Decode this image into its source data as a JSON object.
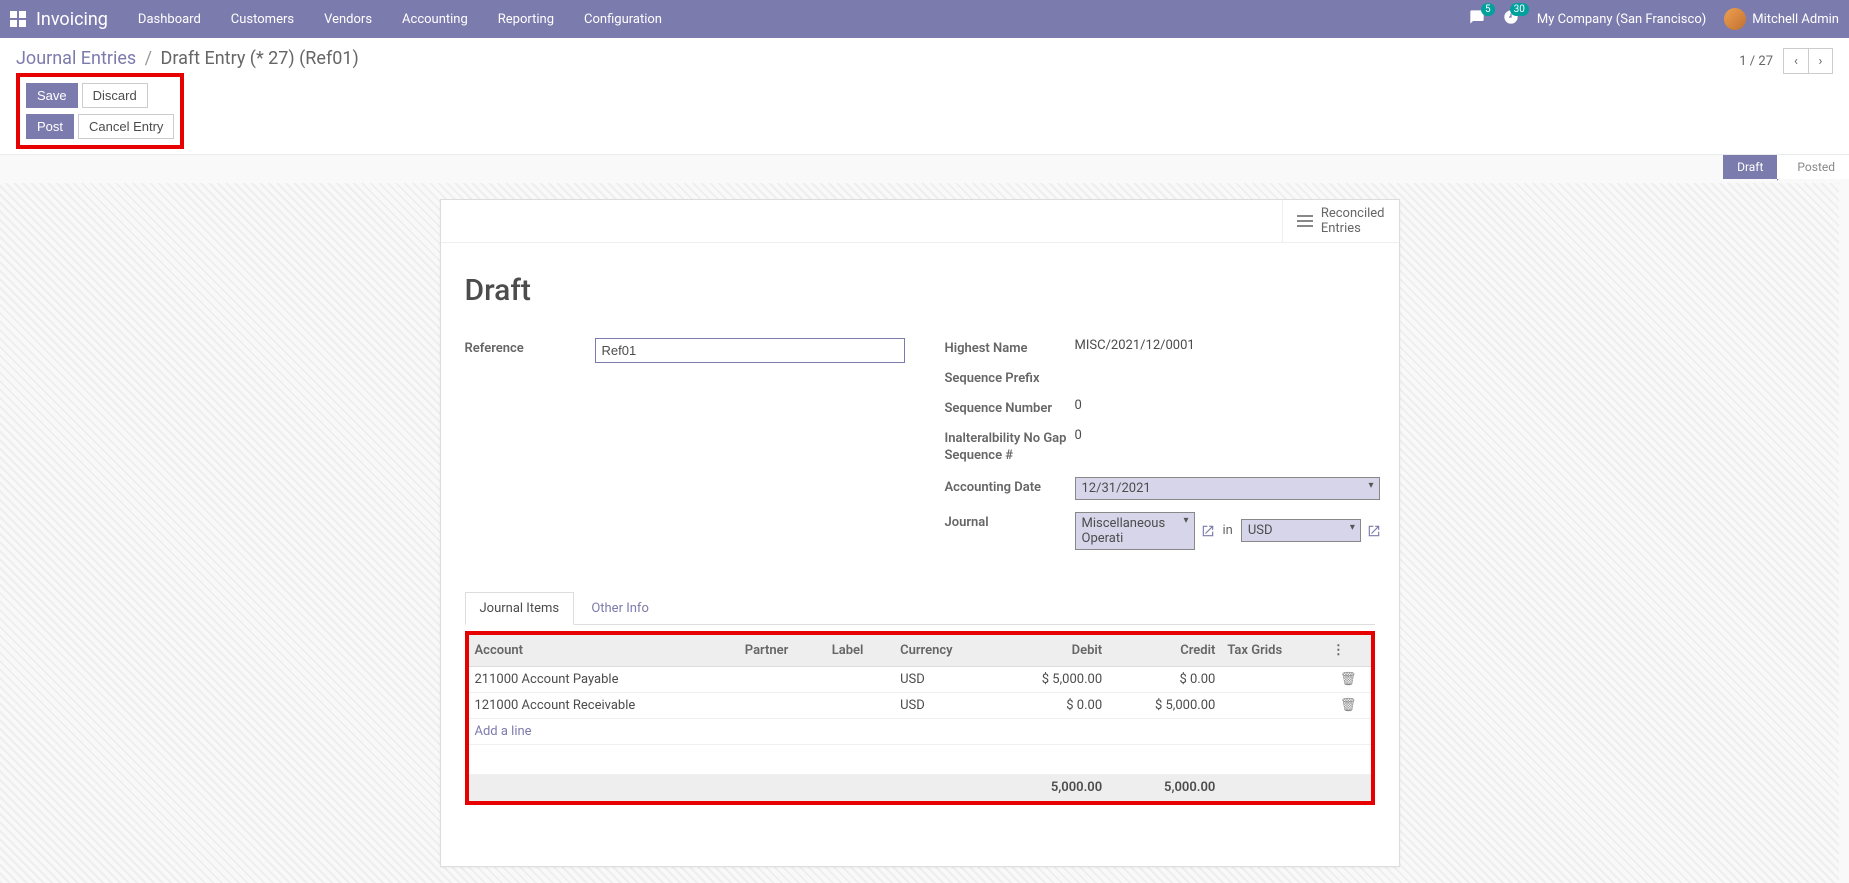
{
  "topbar": {
    "app_name": "Invoicing",
    "menu": [
      "Dashboard",
      "Customers",
      "Vendors",
      "Accounting",
      "Reporting",
      "Configuration"
    ],
    "msg_badge": "5",
    "activity_badge": "30",
    "company": "My Company (San Francisco)",
    "user": "Mitchell Admin"
  },
  "breadcrumb": {
    "parent": "Journal Entries",
    "current": "Draft Entry (* 27) (Ref01)"
  },
  "buttons": {
    "save": "Save",
    "discard": "Discard",
    "post": "Post",
    "cancel_entry": "Cancel Entry"
  },
  "pager": "1 / 27",
  "status": {
    "draft": "Draft",
    "posted": "Posted"
  },
  "reconciled": {
    "l1": "Reconciled",
    "l2": "Entries"
  },
  "form": {
    "title": "Draft",
    "labels": {
      "reference": "Reference",
      "highest_name": "Highest Name",
      "sequence_prefix": "Sequence Prefix",
      "sequence_number": "Sequence Number",
      "inalter": "Inalteralbility No Gap Sequence #",
      "accounting_date": "Accounting Date",
      "journal": "Journal",
      "in": "in"
    },
    "values": {
      "reference": "Ref01",
      "highest_name": "MISC/2021/12/0001",
      "sequence_prefix": "",
      "sequence_number": "0",
      "inalter": "0",
      "accounting_date": "12/31/2021",
      "journal": "Miscellaneous Operati",
      "currency": "USD"
    }
  },
  "tabs": {
    "journal_items": "Journal Items",
    "other_info": "Other Info"
  },
  "table": {
    "headers": {
      "account": "Account",
      "partner": "Partner",
      "label": "Label",
      "currency": "Currency",
      "debit": "Debit",
      "credit": "Credit",
      "tax_grids": "Tax Grids"
    },
    "rows": [
      {
        "account": "211000 Account Payable",
        "partner": "",
        "label": "",
        "currency": "USD",
        "debit": "$ 5,000.00",
        "credit": "$ 0.00",
        "tax": ""
      },
      {
        "account": "121000 Account Receivable",
        "partner": "",
        "label": "",
        "currency": "USD",
        "debit": "$ 0.00",
        "credit": "$ 5,000.00",
        "tax": ""
      }
    ],
    "add_line": "Add a line",
    "totals": {
      "debit": "5,000.00",
      "credit": "5,000.00"
    }
  }
}
